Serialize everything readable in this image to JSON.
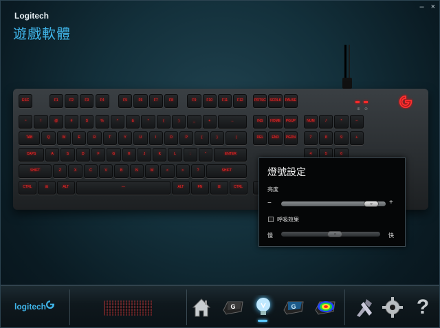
{
  "window": {
    "brand": "Logitech",
    "title": "遊戲軟體",
    "min": "–",
    "close": "×"
  },
  "keyboard": {
    "rows": [
      [
        "ESC",
        "F1",
        "F2",
        "F3",
        "F4",
        "F5",
        "F6",
        "F7",
        "F8",
        "F9",
        "F10",
        "F11",
        "F12",
        "PRTSC",
        "SCRLK",
        "PAUSE"
      ],
      [
        "~",
        "!",
        "@",
        "#",
        "$",
        "%",
        "^",
        "&",
        "*",
        "(",
        ")",
        "_",
        "+",
        "←",
        "INS",
        "HOME",
        "PGUP",
        "NUM",
        "/",
        "*",
        "–"
      ],
      [
        "TAB",
        "Q",
        "W",
        "E",
        "R",
        "T",
        "Y",
        "U",
        "I",
        "O",
        "P",
        "{",
        "}",
        "|",
        "DEL",
        "END",
        "PGDN",
        "7",
        "8",
        "9",
        "+"
      ],
      [
        "CAPS",
        "A",
        "S",
        "D",
        "F",
        "G",
        "H",
        "J",
        "K",
        "L",
        ":",
        "\"",
        "ENTER",
        "4",
        "5",
        "6"
      ],
      [
        "SHIFT",
        "Z",
        "X",
        "C",
        "V",
        "B",
        "N",
        "M",
        "<",
        ">",
        "?",
        "SHIFT",
        "↑",
        "1",
        "2",
        "3",
        "ENTER"
      ],
      [
        "CTRL",
        "⊞",
        "ALT",
        "—",
        "ALT",
        "FN",
        "☰",
        "CTRL",
        "←",
        "↓",
        "→",
        "0",
        "."
      ]
    ]
  },
  "lighting_popup": {
    "title": "燈號設定",
    "brightness_label": "亮度",
    "minus": "−",
    "plus": "+",
    "brightness_value": 0.92,
    "breathing_label": "呼吸效果",
    "breathing_checked": false,
    "slow_label": "慢",
    "fast_label": "快",
    "speed_value": 0.55
  },
  "bottombar": {
    "logo_text": "logitech",
    "nav": [
      "home-icon",
      "g-key-icon",
      "lighting-icon",
      "g-key-blue-icon",
      "heatmap-icon",
      "tools-icon",
      "settings-icon",
      "help-icon"
    ],
    "active": "lighting-icon",
    "help_glyph": "?"
  },
  "colors": {
    "accent": "#3fb4e8",
    "key_light": "#ff2a2a"
  }
}
